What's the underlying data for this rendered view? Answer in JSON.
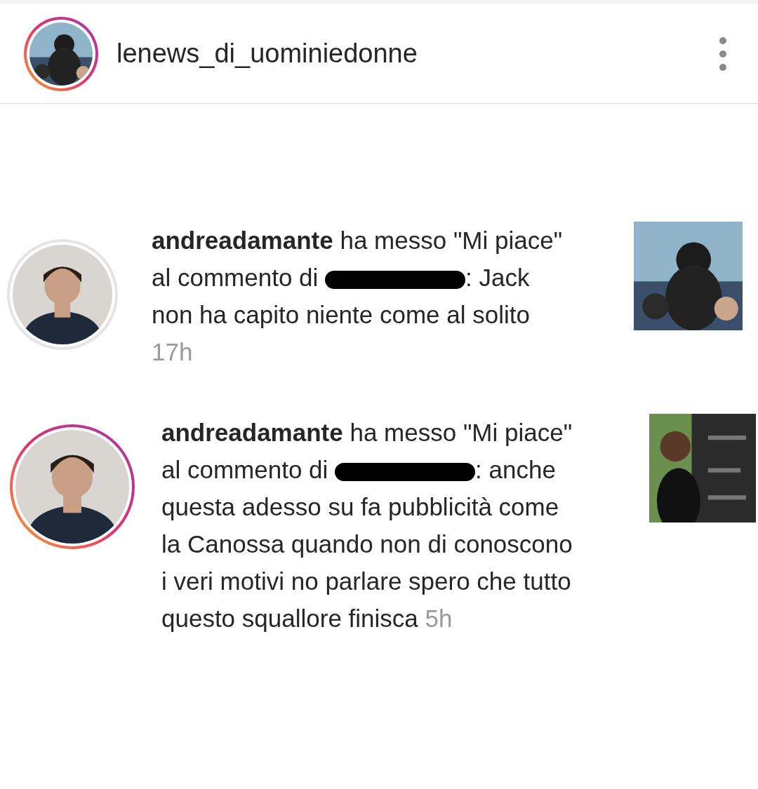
{
  "header": {
    "username": "lenews_di_uominiedonne",
    "has_story": true
  },
  "notifications": [
    {
      "username": "andreadamante",
      "action": "ha messo \"Mi piace\" al commento di",
      "redacted": true,
      "comment": ": Jack non ha capito niente come al solito",
      "time": "17h",
      "has_story": false
    },
    {
      "username": "andreadamante",
      "action": "ha messo \"Mi piace\" al commento di",
      "redacted": true,
      "comment": ": anche questa adesso su fa pubblicità come la Canossa quando non di conoscono i veri  motivi no parlare  spero che tutto questo squallore finisca",
      "time": "5h",
      "has_story": true
    }
  ]
}
